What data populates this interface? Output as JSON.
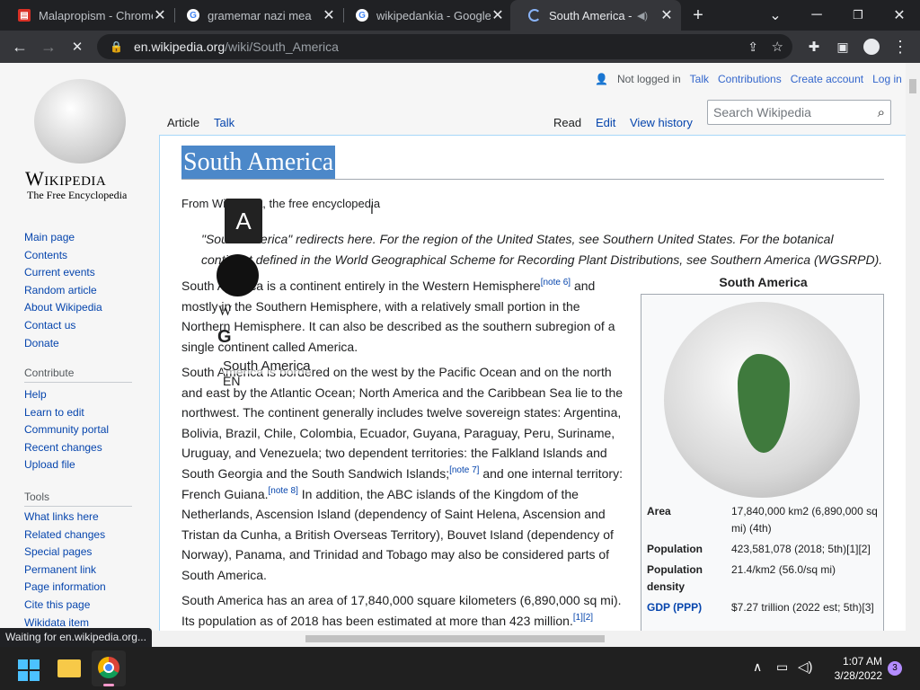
{
  "tabs": [
    {
      "title": "Malapropism - Chrome",
      "favicon": "red-pdf-icon"
    },
    {
      "title": "gramemar nazi mea",
      "favicon": "google-icon"
    },
    {
      "title": "wikipedankia - Google",
      "favicon": "google-icon"
    },
    {
      "title": "South America - W",
      "favicon": "loading-icon"
    }
  ],
  "toolbar": {
    "url_domain": "en.wikipedia.org",
    "url_path": "/wiki/South_America"
  },
  "wiki": {
    "logo_title": "Wikipedia",
    "logo_subtitle": "The Free Encyclopedia",
    "user_links": [
      "Not logged in",
      "Talk",
      "Contributions",
      "Create account",
      "Log in"
    ],
    "page_tabs": {
      "article": "Article",
      "talk": "Talk",
      "read": "Read",
      "edit": "Edit",
      "history": "View history"
    },
    "search_placeholder": "Search Wikipedia",
    "title": "South America",
    "tagline": "From Wikipedia, the free encyclopedia",
    "hatnote": "\"South America\" redirects here. For the region of the United States, see Southern United States. For the botanical continent defined in the World Geographical Scheme for Recording Plant Distributions, see Southern America (WGSRPD).",
    "p1_lines": [
      "South America is a continent entirely in the Western Hemisphere",
      "mostly in the Southern Hemisphere, with a relatively small portion in the",
      "Northern Hemisphere. It can also be described as the southern subregion of a",
      "single continent called America."
    ],
    "p1_sup": "[note 6]",
    "p1_and": " and",
    "p2_lines": [
      "South America is bordered on the west by the Pacific Ocean and on the north",
      "and east by the Atlantic Ocean; North America and the Caribbean Sea lie to the",
      "northwest. The continent generally includes twelve sovereign states: Argentina,",
      "Bolivia, Brazil, Chile, Colombia, Ecuador, Guyana, Paraguay, Peru, Suriname,",
      "Uruguay, and Venezuela; two dependent territories: the Falkland Islands and",
      "South Georgia and the South Sandwich Islands;",
      "French Guiana.",
      "Netherlands, Ascension Island (dependency of Saint Helena, Ascension and",
      "Tristan da Cunha, a British Overseas Territory), Bouvet Island (dependency of",
      "Norway), Panama, and Trinidad and Tobago may also be considered parts of",
      "South America."
    ],
    "p2_sup7": "[note 7]",
    "p2_tail7": " and one internal territory:",
    "p2_sup8": "[note 8]",
    "p2_tail8": " In addition, the ABC islands of the Kingdom of the",
    "p3_lines": [
      "South America has an area of 17,840,000 square kilometers (6,890,000 sq mi).",
      "Its population as of 2018 has been estimated at more than 423 million."
    ],
    "p3_sup": "[1][2]",
    "infobox": {
      "title": "South America",
      "rows": [
        {
          "label": "Area",
          "value": "17,840,000 km2 (6,890,000 sq mi) (4th)"
        },
        {
          "label": "Population",
          "value": "423,581,078 (2018; 5th)[1][2]"
        },
        {
          "label": "Population density",
          "value": "21.4/km2 (56.0/sq mi)"
        },
        {
          "label": "GDP (PPP)",
          "value": "$7.27 trillion (2022 est; 5th)[3]"
        }
      ]
    },
    "sidebar": {
      "nav": [
        "Main page",
        "Contents",
        "Current events",
        "Random article",
        "About Wikipedia",
        "Contact us",
        "Donate"
      ],
      "contribute_heading": "Contribute",
      "contribute": [
        "Help",
        "Learn to edit",
        "Community portal",
        "Recent changes",
        "Upload file"
      ],
      "tools_heading": "Tools",
      "tools": [
        "What links here",
        "Related changes",
        "Special pages",
        "Permanent link",
        "Page information",
        "Cite this page",
        "Wikidata item"
      ]
    }
  },
  "overlay": {
    "letter": "A",
    "w": "W",
    "g": "G",
    "label": "South America",
    "lang": "EN"
  },
  "status": "Waiting for en.wikipedia.org...",
  "taskbar": {
    "time": "1:07 AM",
    "date": "3/28/2022",
    "badge": "3"
  }
}
